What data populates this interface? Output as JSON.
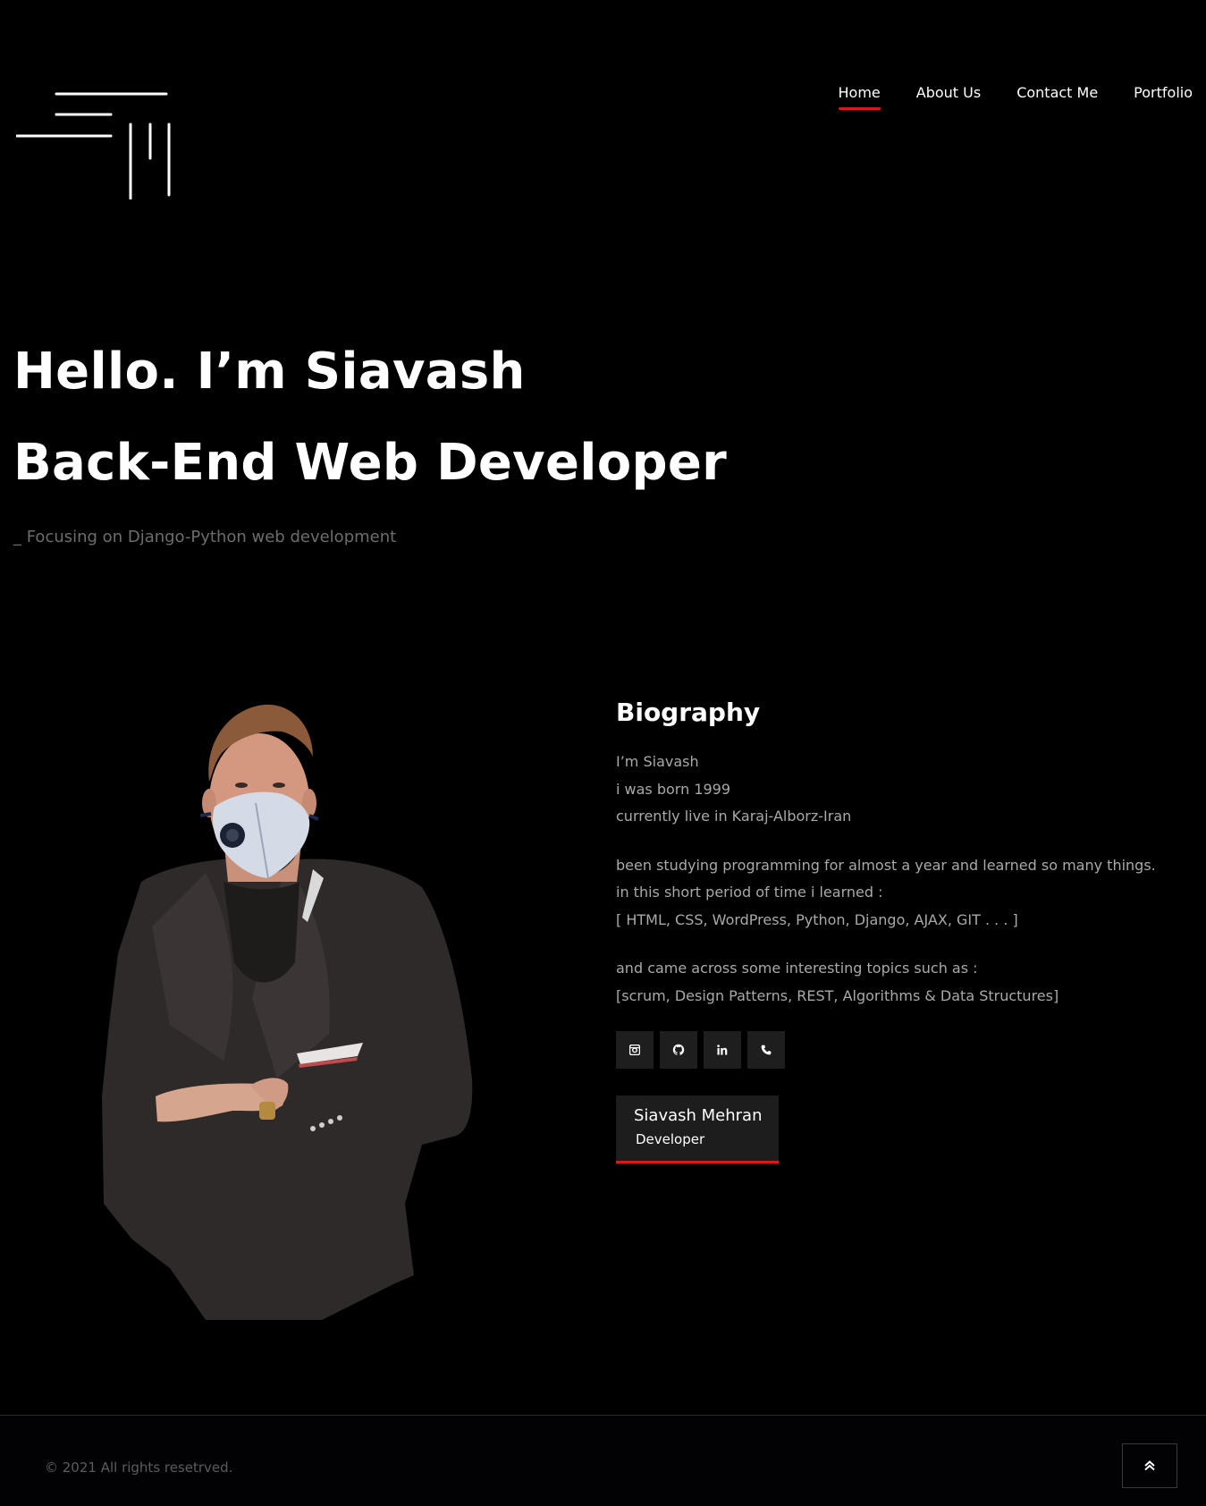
{
  "nav": {
    "items": [
      {
        "label": "Home",
        "active": true
      },
      {
        "label": "About Us",
        "active": false
      },
      {
        "label": "Contact Me",
        "active": false
      },
      {
        "label": "Portfolio",
        "active": false
      }
    ]
  },
  "hero": {
    "line1": "Hello. I’m Siavash",
    "line2": "Back-End Web Developer",
    "subtitle": "_ Focusing on Django-Python web development"
  },
  "bio": {
    "title": "Biography",
    "block1": [
      "I’m Siavash",
      "i was born 1999",
      "currently live in Karaj-Alborz-Iran"
    ],
    "block2": [
      "been studying programming for almost a year and learned so many things.",
      "in this short period of time i learned :",
      "[ HTML, CSS, WordPress, Python, Django, AJAX, GIT . . . ]"
    ],
    "block3": [
      "and came across some interesting topics such as :",
      "[scrum, Design Patterns, REST, Algorithms & Data Structures]"
    ]
  },
  "socials": [
    "instagram-icon",
    "github-icon",
    "linkedin-icon",
    "phone-icon"
  ],
  "signature": {
    "name": "Siavash Mehran",
    "role": "Developer"
  },
  "footer": {
    "copyright": "© 2021 All rights resetrved."
  },
  "colors": {
    "background": "#000000",
    "accent": "#e1161b",
    "muted_text": "#a9a9a9",
    "social_bg": "#1e1e1e"
  }
}
